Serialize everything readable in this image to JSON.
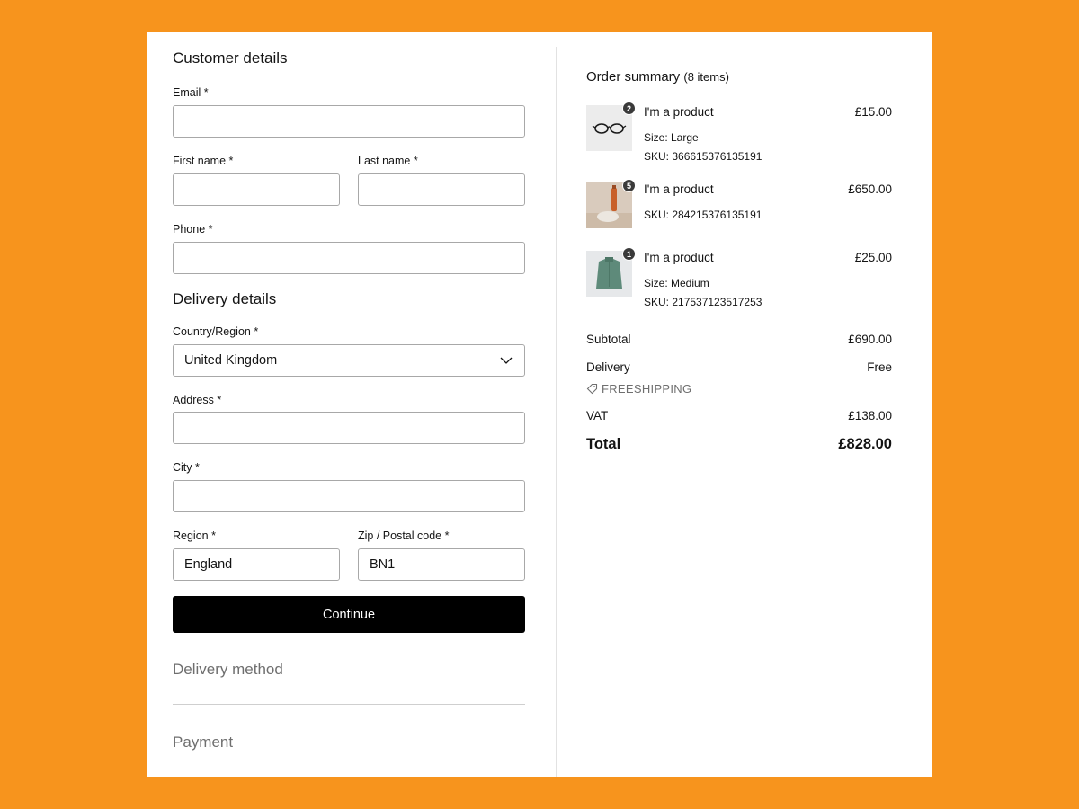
{
  "customer": {
    "title": "Customer details",
    "email_label": "Email *",
    "first_name_label": "First name *",
    "last_name_label": "Last name *",
    "phone_label": "Phone *"
  },
  "delivery": {
    "title": "Delivery details",
    "country_label": "Country/Region *",
    "country_value": "United Kingdom",
    "address_label": "Address *",
    "city_label": "City *",
    "region_label": "Region *",
    "region_value": "England",
    "zip_label": "Zip / Postal code *",
    "zip_value": "BN1",
    "continue_label": "Continue"
  },
  "steps": {
    "delivery_method": "Delivery method",
    "payment": "Payment"
  },
  "summary": {
    "title": "Order summary",
    "count": "(8 items)",
    "items": [
      {
        "name": "I'm a product",
        "price": "£15.00",
        "qty": "2",
        "size": "Size: Large",
        "sku": "SKU: 366615376135191",
        "icon": "glasses-icon"
      },
      {
        "name": "I'm a product",
        "price": "£650.00",
        "qty": "5",
        "sku": "SKU: 284215376135191",
        "icon": "bottle-icon"
      },
      {
        "name": "I'm a product",
        "price": "£25.00",
        "qty": "1",
        "size": "Size: Medium",
        "sku": "SKU: 217537123517253",
        "icon": "sweater-icon"
      }
    ],
    "subtotal_label": "Subtotal",
    "subtotal_value": "£690.00",
    "delivery_label": "Delivery",
    "delivery_value": "Free",
    "coupon": "FREESHIPPING",
    "vat_label": "VAT",
    "vat_value": "£138.00",
    "total_label": "Total",
    "total_value": "£828.00"
  },
  "colors": {
    "background": "#F7941D",
    "card": "#FFFFFF",
    "button": "#000000"
  }
}
